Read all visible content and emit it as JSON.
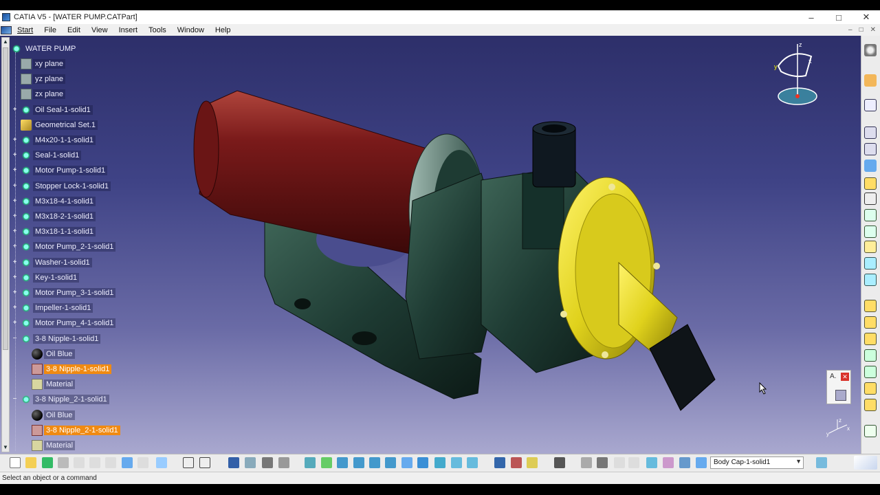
{
  "window": {
    "title": "CATIA V5 - [WATER PUMP.CATPart]",
    "min": "–",
    "max": "□",
    "close": "✕"
  },
  "menu": [
    "Start",
    "File",
    "Edit",
    "View",
    "Insert",
    "Tools",
    "Window",
    "Help"
  ],
  "mdi": {
    "min": "–",
    "max": "□",
    "close": "✕"
  },
  "tree": {
    "root": "WATER PUMP",
    "items": [
      {
        "label": "xy plane",
        "icon": "plane-icon"
      },
      {
        "label": "yz plane",
        "icon": "plane-icon"
      },
      {
        "label": "zx plane",
        "icon": "plane-icon"
      },
      {
        "label": "Oil Seal-1-solid1",
        "icon": "body-gear-icon"
      },
      {
        "label": "Geometrical Set.1",
        "icon": "geometrical-set-icon"
      },
      {
        "label": "M4x20-1-1-solid1",
        "icon": "body-gear-icon"
      },
      {
        "label": "Seal-1-solid1",
        "icon": "body-gear-icon"
      },
      {
        "label": "Motor Pump-1-solid1",
        "icon": "body-gear-icon"
      },
      {
        "label": "Stopper Lock-1-solid1",
        "icon": "body-gear-icon"
      },
      {
        "label": "M3x18-4-1-solid1",
        "icon": "body-gear-icon"
      },
      {
        "label": "M3x18-2-1-solid1",
        "icon": "body-gear-icon"
      },
      {
        "label": "M3x18-1-1-solid1",
        "icon": "body-gear-icon"
      },
      {
        "label": "Motor Pump_2-1-solid1",
        "icon": "body-gear-icon"
      },
      {
        "label": "Washer-1-solid1",
        "icon": "body-gear-icon"
      },
      {
        "label": "Key-1-solid1",
        "icon": "body-gear-icon"
      },
      {
        "label": "Motor Pump_3-1-solid1",
        "icon": "body-gear-icon"
      },
      {
        "label": "Impeller-1-solid1",
        "icon": "body-gear-icon"
      },
      {
        "label": "Motor Pump_4-1-solid1",
        "icon": "body-gear-icon"
      },
      {
        "label": "3-8 Nipple-1-solid1",
        "icon": "body-gear-icon"
      },
      {
        "label": "Oil Blue",
        "icon": "appearance-ball-icon"
      },
      {
        "label": "3-8 Nipple-1-solid1",
        "icon": "partbody-icon"
      },
      {
        "label": "Material",
        "icon": "material-icon"
      },
      {
        "label": "3-8 Nipple_2-1-solid1",
        "icon": "body-gear-icon"
      },
      {
        "label": "Oil Blue",
        "icon": "appearance-ball-icon"
      },
      {
        "label": "3-8 Nipple_2-1-solid1",
        "icon": "partbody-icon"
      },
      {
        "label": "Material",
        "icon": "material-icon"
      }
    ]
  },
  "compass": {
    "z": "z",
    "x": "x",
    "y": "y"
  },
  "axis_triad": {
    "z": "z",
    "x": "x",
    "y": "y"
  },
  "mini_window": {
    "label": "A.",
    "close": "✕"
  },
  "current_body": "Body Cap-1-solid1",
  "status_text": "Select an object or a command",
  "colors": {
    "viewport_top": "#2d2f6a",
    "viewport_bottom": "#a9a8cf",
    "highlight": "#f08a12",
    "cap": "#e0d21c",
    "motor": "#7a1a1a",
    "housing": "#1e3b33"
  }
}
